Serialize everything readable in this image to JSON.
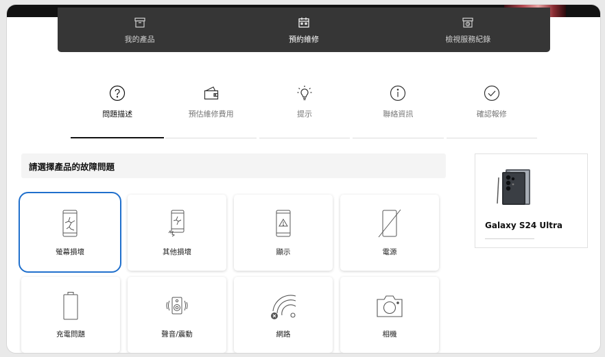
{
  "service_nav": {
    "items": [
      {
        "label": "我的產品",
        "icon": "product-box-icon",
        "active": false
      },
      {
        "label": "預約維修",
        "icon": "calendar-icon",
        "active": true
      },
      {
        "label": "檢視服務紀錄",
        "icon": "history-box-icon",
        "active": false
      }
    ]
  },
  "steps": [
    {
      "label": "問題描述",
      "icon": "question-circle-icon",
      "active": true
    },
    {
      "label": "預估維修費用",
      "icon": "wallet-icon",
      "active": false
    },
    {
      "label": "提示",
      "icon": "lightbulb-icon",
      "active": false
    },
    {
      "label": "聯絡資訊",
      "icon": "info-circle-icon",
      "active": false
    },
    {
      "label": "確認報修",
      "icon": "check-circle-icon",
      "active": false
    }
  ],
  "question": {
    "title": "請選擇產品的故障問題"
  },
  "issues": [
    {
      "label": "螢幕損壞",
      "icon": "cracked-screen-icon",
      "selected": true
    },
    {
      "label": "其他損壞",
      "icon": "damaged-phone-icon",
      "selected": false
    },
    {
      "label": "顯示",
      "icon": "display-warning-icon",
      "selected": false
    },
    {
      "label": "電源",
      "icon": "power-off-icon",
      "selected": false
    },
    {
      "label": "充電問題",
      "icon": "battery-icon",
      "selected": false
    },
    {
      "label": "聲音/震動",
      "icon": "speaker-vibration-icon",
      "selected": false
    },
    {
      "label": "網路",
      "icon": "network-off-icon",
      "selected": false
    },
    {
      "label": "相機",
      "icon": "camera-icon",
      "selected": false
    }
  ],
  "product": {
    "name": "Galaxy S24 Ultra",
    "image_icon": "galaxy-phone-image"
  },
  "colors": {
    "selected_border": "#1f6fcc",
    "nav_bg": "#363636",
    "active_tab_underline": "#111111"
  }
}
